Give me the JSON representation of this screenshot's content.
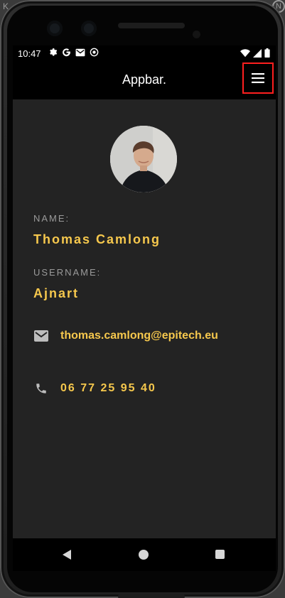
{
  "corner": {
    "text": "K",
    "logo_text": "N"
  },
  "status_bar": {
    "time": "10:47",
    "left_icons": [
      "settings-icon",
      "google-icon",
      "gmail-icon",
      "sync-icon"
    ],
    "right_icons": [
      "wifi-icon",
      "signal-icon",
      "battery-icon"
    ]
  },
  "appbar": {
    "title": "Appbar.",
    "menu_icon": "hamburger-menu-icon",
    "highlight_color": "#ff1f1f"
  },
  "profile": {
    "avatar_alt": "profile-avatar",
    "name_label": "NAME:",
    "name_value": "Thomas Camlong",
    "username_label": "USERNAME:",
    "username_value": "Ajnart",
    "email": "thomas.camlong@epitech.eu",
    "email_icon": "mail-icon",
    "phone": "06 77 25 95 40",
    "phone_icon": "phone-icon"
  },
  "navbar": {
    "buttons": [
      "back-button",
      "home-button",
      "recent-apps-button"
    ]
  },
  "colors": {
    "accent": "#f6c84d",
    "background": "#232323",
    "appbar": "#000000",
    "label": "#9a9a9a"
  }
}
